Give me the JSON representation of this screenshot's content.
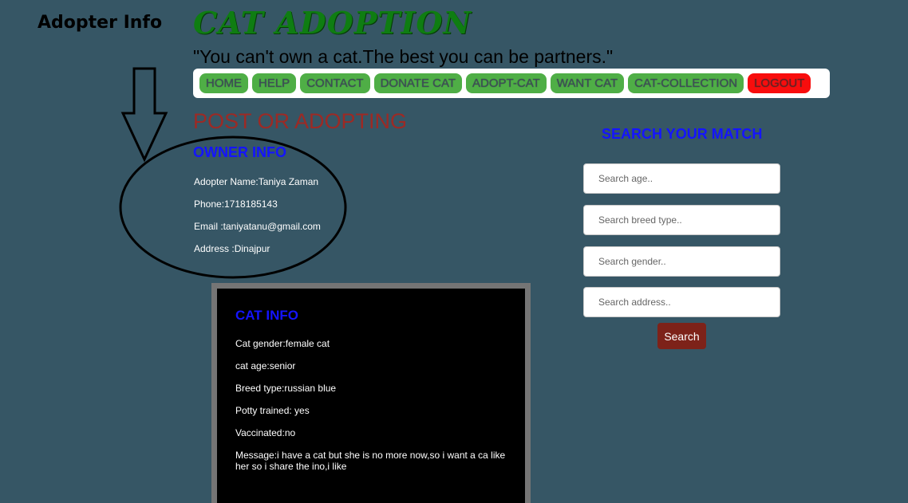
{
  "annotation": {
    "title": "Adopter Info"
  },
  "header": {
    "title": "CAT ADOPTION",
    "tagline": "\"You can't own a cat.The best you can be partners.\""
  },
  "nav": {
    "items": [
      "HOME",
      "HELP",
      "CONTACT",
      "DONATE CAT",
      "ADOPT-CAT",
      "WANT CAT",
      "CAT-COLLECTION"
    ],
    "logout": "LOGOUT"
  },
  "post": {
    "heading": "POST OR ADOPTING",
    "owner_heading": "OWNER INFO",
    "owner_lines": [
      "Adopter Name:Taniya Zaman",
      "Phone:1718185143",
      "Email :taniyatanu@gmail.com",
      "Address :Dinajpur"
    ]
  },
  "cat": {
    "heading": "CAT INFO",
    "lines": [
      "Cat gender:female cat",
      "cat age:senior",
      "Breed type:russian blue",
      "Potty trained: yes",
      "Vaccinated:no",
      "Message:i have a cat but she is no more now,so i want a ca like her so i share the ino,i like"
    ]
  },
  "search": {
    "heading": "SEARCH YOUR MATCH",
    "placeholders": [
      "Search age..",
      "Search breed type..",
      "Search gender..",
      "Search address.."
    ],
    "button": "Search"
  },
  "colors": {
    "background": "#365665",
    "title_green": "#0f7d12",
    "nav_green": "#4fae46",
    "logout_red": "#f80d0d",
    "heading_blue": "#1414ff",
    "post_red": "#9c2a25",
    "search_button": "#7d2219"
  }
}
